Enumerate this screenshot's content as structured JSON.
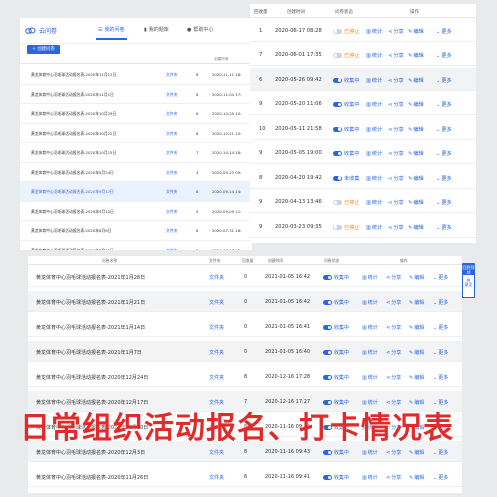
{
  "colors": {
    "accent": "#2a66e0",
    "stopped": "#f08a24",
    "caption": "#e12a2a"
  },
  "app": {
    "logo_text": "云问卷",
    "tabs": [
      {
        "label": "我的问卷",
        "icon": "list-icon"
      },
      {
        "label": "我的题库",
        "icon": "book-icon"
      },
      {
        "label": "帮助中心",
        "icon": "help-icon"
      }
    ],
    "new_button": "+ 创建问卷",
    "table_headers": {
      "count": "",
      "time": "创建时间"
    },
    "rows": [
      {
        "name": "黄龙体育中心羽毛球活动报名表-2020年11月12日",
        "folder": "文件夹",
        "count": "6",
        "time": "2020-11-11 16:"
      },
      {
        "name": "黄龙体育中心羽毛球活动报名表-2020年11月1日",
        "folder": "文件夹",
        "count": "8",
        "time": "2020-11-04 17:"
      },
      {
        "name": "黄龙体育中心羽毛球活动报名表-2020年10月29日",
        "folder": "文件夹",
        "count": "6",
        "time": "2020-10-29 10:"
      },
      {
        "name": "黄龙体育中心羽毛球活动报名表-2020年10月22日",
        "folder": "文件夹",
        "count": "8",
        "time": "2020-10-21 15:"
      },
      {
        "name": "黄龙体育中心羽毛球活动报名表-2020年10月15日",
        "folder": "文件夹",
        "count": "7",
        "time": "2020-10-14 18:"
      },
      {
        "name": "黄龙体育中心羽毛球活动报名表-2020年9月24日",
        "folder": "文件夹",
        "count": "4",
        "time": "2020-09-23 09:"
      },
      {
        "name": "黄龙体育中心羽毛球活动报名表-2020年9月17日",
        "folder": "文件夹",
        "count": "6",
        "time": "2020-09-14 14:"
      },
      {
        "name": "黄龙体育中心羽毛球活动报名表-2020年9月10日",
        "folder": "文件夹",
        "count": "5",
        "time": "2020-09-09 11:"
      },
      {
        "name": "黄龙体育中心羽毛球活动报名表-2020年8月6日",
        "folder": "文件夹",
        "count": "6",
        "time": "2020-07-31 16:"
      },
      {
        "name": "黄龙体育中心羽毛球活动报名表-2020年7月30日",
        "folder": "文件夹",
        "count": "2",
        "time": "2020-06-17 12:"
      }
    ]
  },
  "stats": {
    "headers": {
      "count": "回收量",
      "time": "创建时间",
      "status": "问卷状态",
      "ops": "操作"
    },
    "actions": {
      "stats": "统计",
      "share": "分享",
      "edit": "编辑",
      "more": "更多"
    },
    "rows": [
      {
        "count": "1",
        "time": "2020-06-17 08:28",
        "status": "已停止",
        "on": false
      },
      {
        "count": "7",
        "time": "2020-06-01 17:35",
        "status": "已停止",
        "on": false
      },
      {
        "count": "6",
        "time": "2020-05-26 09:42",
        "status": "收集中",
        "on": true
      },
      {
        "count": "9",
        "time": "2020-05-20 11:06",
        "status": "收集中",
        "on": true
      },
      {
        "count": "10",
        "time": "2020-05-11 21:58",
        "status": "收集中",
        "on": true
      },
      {
        "count": "9",
        "time": "2020-05-05 19:00",
        "status": "收集中",
        "on": true
      },
      {
        "count": "8",
        "time": "2020-04-20 19:42",
        "status": "未收集",
        "on": true
      },
      {
        "count": "9",
        "time": "2020-04-13 13:46",
        "status": "已停止",
        "on": false
      },
      {
        "count": "9",
        "time": "2020-03-23 09:35",
        "status": "已停止",
        "on": false
      }
    ]
  },
  "main": {
    "headers": {
      "name": "问卷名称",
      "folder": "文件夹",
      "count": "回收量",
      "time": "创建时间",
      "status": "问卷状态",
      "ops": "操作"
    },
    "actions": {
      "stats": "统计",
      "share": "分享",
      "edit": "编辑",
      "more": "更多"
    },
    "side_buttons": [
      "回到顶部",
      "意见"
    ],
    "rows": [
      {
        "name": "黄龙体育中心羽毛球活动报名表-2021年1月28日",
        "folder": "文件夹",
        "count": "0",
        "time": "2021-01-05 16:42",
        "status": "收集中"
      },
      {
        "name": "黄龙体育中心羽毛球活动报名表-2021年1月21日",
        "folder": "文件夹",
        "count": "0",
        "time": "2021-01-05 16:42",
        "status": "收集中"
      },
      {
        "name": "黄龙体育中心羽毛球活动报名表-2021年1月14日",
        "folder": "文件夹",
        "count": "0",
        "time": "2021-01-05 16:41",
        "status": "收集中"
      },
      {
        "name": "黄龙体育中心羽毛球活动报名表-2021年1月7日",
        "folder": "文件夹",
        "count": "0",
        "time": "2021-01-05 16:40",
        "status": "收集中"
      },
      {
        "name": "黄龙体育中心羽毛球活动报名表-2020年12月24日",
        "folder": "文件夹",
        "count": "8",
        "time": "2020-12-16 17:28",
        "status": "收集中"
      },
      {
        "name": "黄龙体育中心羽毛球活动报名表-2020年12月17日",
        "folder": "文件夹",
        "count": "7",
        "time": "2020-12-16 17:27",
        "status": "收集中"
      },
      {
        "name": "黄龙体育中心羽毛球活动报名表-2020年12月10日",
        "folder": "文件夹",
        "count": "8",
        "time": "2020-11-16 09:44",
        "status": "收集中"
      },
      {
        "name": "黄龙体育中心羽毛球活动报名表-2020年12月3日",
        "folder": "文件夹",
        "count": "8",
        "time": "2020-11-16 09:43",
        "status": "收集中"
      },
      {
        "name": "黄龙体育中心羽毛球活动报名表-2020年11月26日",
        "folder": "文件夹",
        "count": "6",
        "time": "2020-11-16 09:41",
        "status": "收集中"
      }
    ]
  },
  "caption": "日常组织活动报名、打卡情况表"
}
